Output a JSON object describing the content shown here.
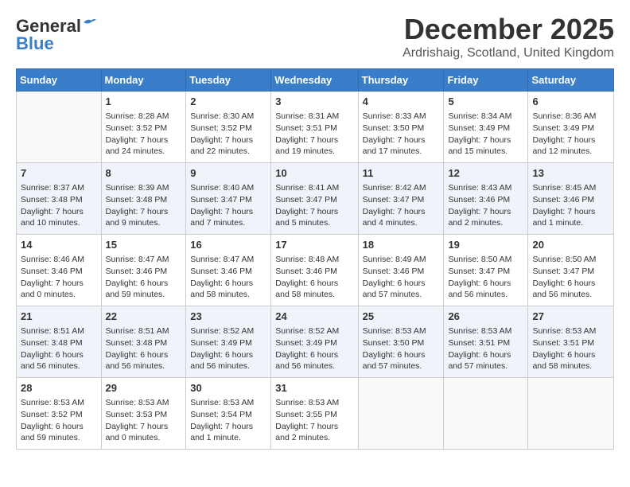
{
  "header": {
    "logo_line1": "General",
    "logo_line2": "Blue",
    "month_title": "December 2025",
    "subtitle": "Ardrishaig, Scotland, United Kingdom"
  },
  "days_of_week": [
    "Sunday",
    "Monday",
    "Tuesday",
    "Wednesday",
    "Thursday",
    "Friday",
    "Saturday"
  ],
  "weeks": [
    [
      {
        "day": "",
        "content": ""
      },
      {
        "day": "1",
        "content": "Sunrise: 8:28 AM\nSunset: 3:52 PM\nDaylight: 7 hours\nand 24 minutes."
      },
      {
        "day": "2",
        "content": "Sunrise: 8:30 AM\nSunset: 3:52 PM\nDaylight: 7 hours\nand 22 minutes."
      },
      {
        "day": "3",
        "content": "Sunrise: 8:31 AM\nSunset: 3:51 PM\nDaylight: 7 hours\nand 19 minutes."
      },
      {
        "day": "4",
        "content": "Sunrise: 8:33 AM\nSunset: 3:50 PM\nDaylight: 7 hours\nand 17 minutes."
      },
      {
        "day": "5",
        "content": "Sunrise: 8:34 AM\nSunset: 3:49 PM\nDaylight: 7 hours\nand 15 minutes."
      },
      {
        "day": "6",
        "content": "Sunrise: 8:36 AM\nSunset: 3:49 PM\nDaylight: 7 hours\nand 12 minutes."
      }
    ],
    [
      {
        "day": "7",
        "content": "Sunrise: 8:37 AM\nSunset: 3:48 PM\nDaylight: 7 hours\nand 10 minutes."
      },
      {
        "day": "8",
        "content": "Sunrise: 8:39 AM\nSunset: 3:48 PM\nDaylight: 7 hours\nand 9 minutes."
      },
      {
        "day": "9",
        "content": "Sunrise: 8:40 AM\nSunset: 3:47 PM\nDaylight: 7 hours\nand 7 minutes."
      },
      {
        "day": "10",
        "content": "Sunrise: 8:41 AM\nSunset: 3:47 PM\nDaylight: 7 hours\nand 5 minutes."
      },
      {
        "day": "11",
        "content": "Sunrise: 8:42 AM\nSunset: 3:47 PM\nDaylight: 7 hours\nand 4 minutes."
      },
      {
        "day": "12",
        "content": "Sunrise: 8:43 AM\nSunset: 3:46 PM\nDaylight: 7 hours\nand 2 minutes."
      },
      {
        "day": "13",
        "content": "Sunrise: 8:45 AM\nSunset: 3:46 PM\nDaylight: 7 hours\nand 1 minute."
      }
    ],
    [
      {
        "day": "14",
        "content": "Sunrise: 8:46 AM\nSunset: 3:46 PM\nDaylight: 7 hours\nand 0 minutes."
      },
      {
        "day": "15",
        "content": "Sunrise: 8:47 AM\nSunset: 3:46 PM\nDaylight: 6 hours\nand 59 minutes."
      },
      {
        "day": "16",
        "content": "Sunrise: 8:47 AM\nSunset: 3:46 PM\nDaylight: 6 hours\nand 58 minutes."
      },
      {
        "day": "17",
        "content": "Sunrise: 8:48 AM\nSunset: 3:46 PM\nDaylight: 6 hours\nand 58 minutes."
      },
      {
        "day": "18",
        "content": "Sunrise: 8:49 AM\nSunset: 3:46 PM\nDaylight: 6 hours\nand 57 minutes."
      },
      {
        "day": "19",
        "content": "Sunrise: 8:50 AM\nSunset: 3:47 PM\nDaylight: 6 hours\nand 56 minutes."
      },
      {
        "day": "20",
        "content": "Sunrise: 8:50 AM\nSunset: 3:47 PM\nDaylight: 6 hours\nand 56 minutes."
      }
    ],
    [
      {
        "day": "21",
        "content": "Sunrise: 8:51 AM\nSunset: 3:48 PM\nDaylight: 6 hours\nand 56 minutes."
      },
      {
        "day": "22",
        "content": "Sunrise: 8:51 AM\nSunset: 3:48 PM\nDaylight: 6 hours\nand 56 minutes."
      },
      {
        "day": "23",
        "content": "Sunrise: 8:52 AM\nSunset: 3:49 PM\nDaylight: 6 hours\nand 56 minutes."
      },
      {
        "day": "24",
        "content": "Sunrise: 8:52 AM\nSunset: 3:49 PM\nDaylight: 6 hours\nand 56 minutes."
      },
      {
        "day": "25",
        "content": "Sunrise: 8:53 AM\nSunset: 3:50 PM\nDaylight: 6 hours\nand 57 minutes."
      },
      {
        "day": "26",
        "content": "Sunrise: 8:53 AM\nSunset: 3:51 PM\nDaylight: 6 hours\nand 57 minutes."
      },
      {
        "day": "27",
        "content": "Sunrise: 8:53 AM\nSunset: 3:51 PM\nDaylight: 6 hours\nand 58 minutes."
      }
    ],
    [
      {
        "day": "28",
        "content": "Sunrise: 8:53 AM\nSunset: 3:52 PM\nDaylight: 6 hours\nand 59 minutes."
      },
      {
        "day": "29",
        "content": "Sunrise: 8:53 AM\nSunset: 3:53 PM\nDaylight: 7 hours\nand 0 minutes."
      },
      {
        "day": "30",
        "content": "Sunrise: 8:53 AM\nSunset: 3:54 PM\nDaylight: 7 hours\nand 1 minute."
      },
      {
        "day": "31",
        "content": "Sunrise: 8:53 AM\nSunset: 3:55 PM\nDaylight: 7 hours\nand 2 minutes."
      },
      {
        "day": "",
        "content": ""
      },
      {
        "day": "",
        "content": ""
      },
      {
        "day": "",
        "content": ""
      }
    ]
  ]
}
